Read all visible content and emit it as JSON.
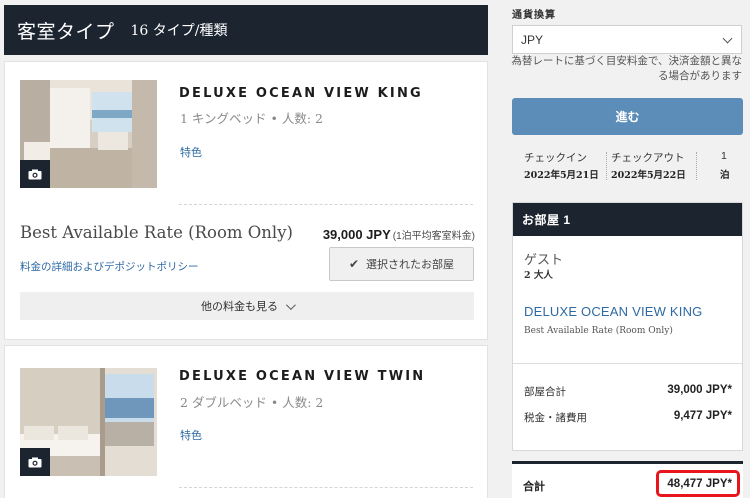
{
  "room_types": {
    "title": "客室タイプ",
    "count": "16 タイプ/種類"
  },
  "rooms": [
    {
      "name": "DELUXE OCEAN VIEW KING",
      "beds": "1 キングベッド • 人数: 2",
      "feature_link": "特色",
      "rate": {
        "name": "Best Available Rate (Room Only)",
        "price": "39,000 JPY",
        "price_note": "(1泊平均客室料金)",
        "policy_link": "料金の詳細およびデポジットポリシー",
        "selected_label": "選択されたお部屋"
      },
      "more_rates_label": "他の料金も見る"
    },
    {
      "name": "DELUXE OCEAN VIEW TWIN",
      "beds": "2 ダブルベッド • 人数: 2",
      "feature_link": "特色"
    }
  ],
  "sidebar": {
    "currency_label": "通貨換算",
    "currency_value": "JPY",
    "currency_note": "為替レートに基づく目安料金で、決済金額と異なる場合があります",
    "proceed_label": "進む",
    "checkin_label": "チェックイン",
    "checkin_date": "2022年5月21日",
    "checkout_label": "チェックアウト",
    "checkout_date": "2022年5月22日",
    "nights_value": "1",
    "nights_unit": "泊",
    "room_header": "お部屋 1",
    "guest_label": "ゲスト",
    "guest_value": "2 大人",
    "room_name": "DELUXE OCEAN VIEW KING",
    "rate_name": "Best Available Rate (Room Only)",
    "room_total_label": "部屋合計",
    "room_total_value": "39,000 JPY*",
    "tax_label": "税金・諸費用",
    "tax_value": "9,477 JPY*",
    "total_label": "合計",
    "total_value": "48,477 JPY*"
  },
  "colors": {
    "header_bg": "#1c2430",
    "link": "#2d6aa3",
    "button": "#5c8cb8",
    "highlight": "#e8151b"
  }
}
